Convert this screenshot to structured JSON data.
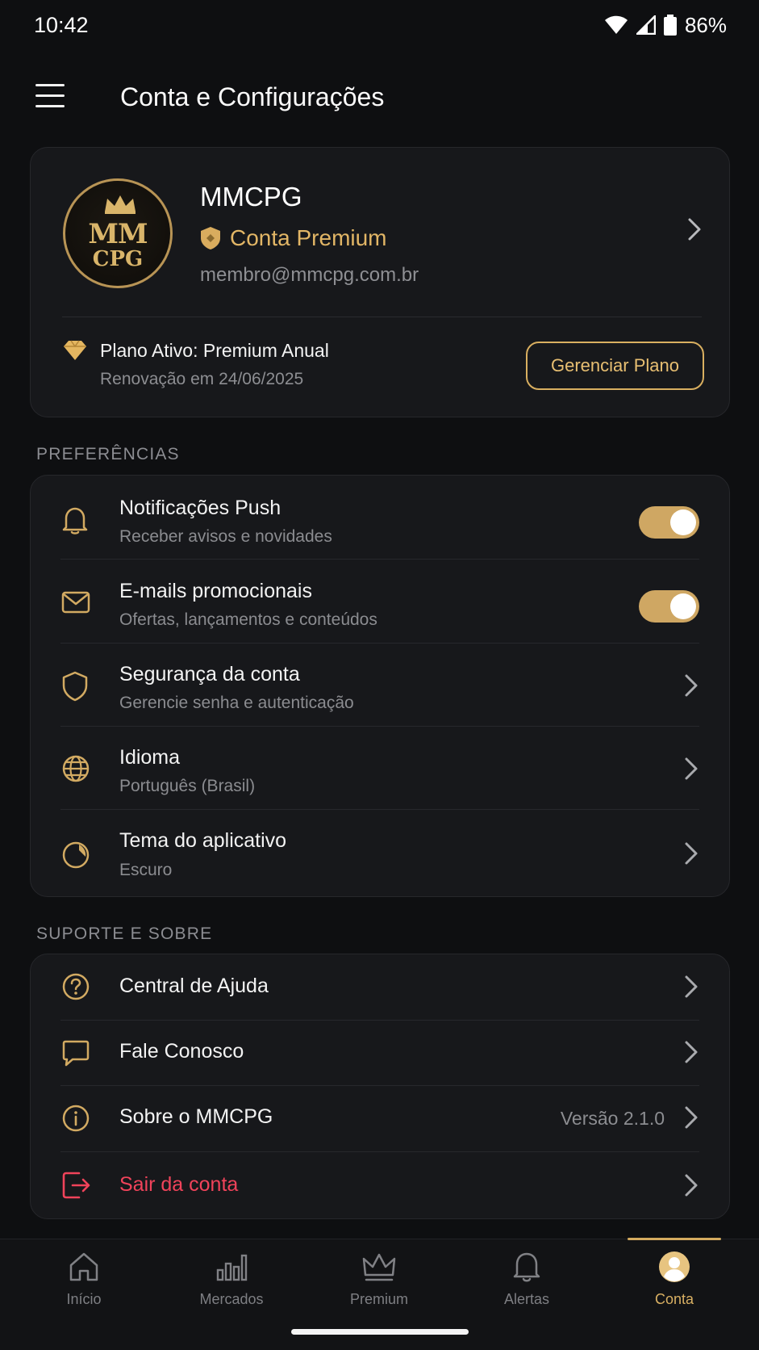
{
  "status_bar": {
    "time": "10:42",
    "battery": "86%"
  },
  "header": {
    "title": "Conta e Configurações"
  },
  "profile": {
    "logo_top": "MM",
    "logo_bottom": "CPG",
    "name": "MMCPG",
    "badge": "Conta Premium",
    "email": "membro@mmcpg.com.br",
    "plan_title": "Plano Ativo: Premium Anual",
    "plan_renewal": "Renovação em 24/06/2025",
    "manage_button": "Gerenciar Plano"
  },
  "preferences": {
    "section_label": "PREFERÊNCIAS",
    "items": [
      {
        "title": "Notificações Push",
        "subtitle": "Receber avisos e novidades",
        "icon": "bell-icon",
        "toggle": true
      },
      {
        "title": "E-mails promocionais",
        "subtitle": "Ofertas, lançamentos e conteúdos",
        "icon": "mail-icon",
        "toggle": true
      },
      {
        "title": "Segurança da conta",
        "subtitle": "Gerencie senha e autenticação",
        "icon": "shield-icon"
      },
      {
        "title": "Idioma",
        "subtitle": "Português (Brasil)",
        "icon": "globe-icon"
      },
      {
        "title": "Tema do aplicativo",
        "subtitle": "Escuro",
        "icon": "theme-icon"
      }
    ]
  },
  "support": {
    "section_label": "SUPORTE E SOBRE",
    "items": [
      {
        "title": "Central de Ajuda",
        "icon": "help-icon"
      },
      {
        "title": "Fale Conosco",
        "icon": "chat-icon"
      },
      {
        "title": "Sobre o MMCPG",
        "value": "Versão 2.1.0",
        "icon": "info-icon"
      },
      {
        "title": "Sair da conta",
        "icon": "logout-icon"
      }
    ]
  },
  "bottom_nav": {
    "items": [
      {
        "label": "Início",
        "icon": "home-icon"
      },
      {
        "label": "Mercados",
        "icon": "bar-chart-icon"
      },
      {
        "label": "Premium",
        "icon": "crown-icon"
      },
      {
        "label": "Alertas",
        "icon": "bell-icon"
      },
      {
        "label": "Conta",
        "icon": "user-icon",
        "active": true
      }
    ]
  },
  "colors": {
    "accent": "#d9b063",
    "background": "#0e0f11",
    "card": "#17181b",
    "danger": "#f0435a"
  }
}
